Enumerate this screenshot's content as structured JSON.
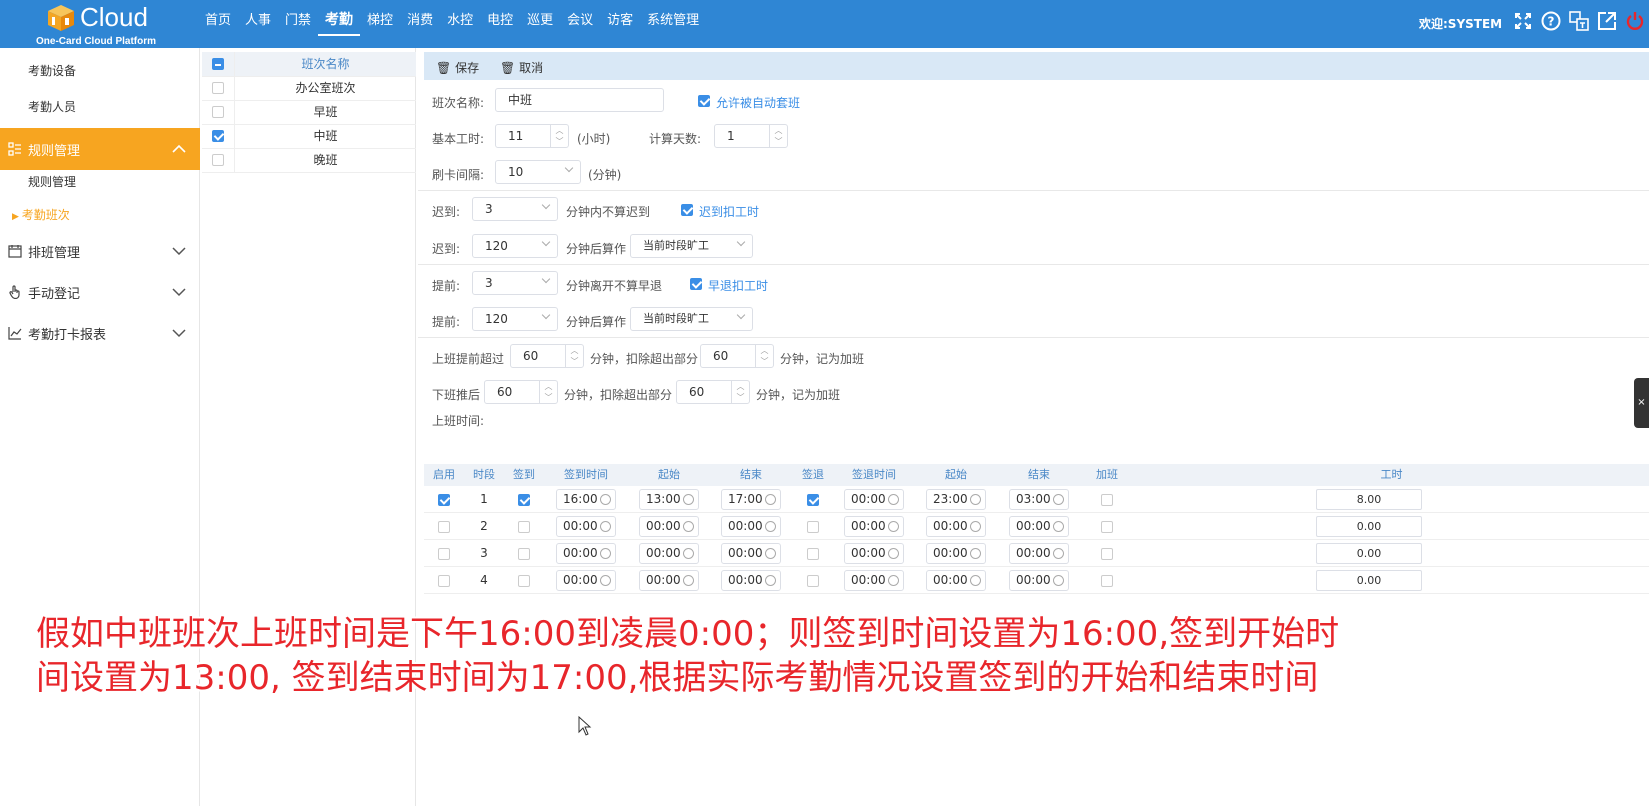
{
  "header": {
    "logo_word": "Cloud",
    "logo_sub": "One-Card Cloud Platform",
    "nav": [
      "首页",
      "人事",
      "门禁",
      "考勤",
      "梯控",
      "消费",
      "水控",
      "电控",
      "巡更",
      "会议",
      "访客",
      "系统管理"
    ],
    "active_nav": "考勤",
    "welcome": "欢迎:SYSTEM",
    "icons": [
      "fullscreen-icon",
      "help-icon",
      "language-icon",
      "export-icon",
      "power-icon"
    ],
    "accent": "#2f86d4"
  },
  "sidebar": {
    "sub_top": [
      "考勤设备",
      "考勤人员"
    ],
    "rule_group": "规则管理",
    "rule_items": [
      "规则管理",
      "考勤班次"
    ],
    "active_item": "考勤班次",
    "groups": [
      "排班管理",
      "手动登记",
      "考勤打卡报表"
    ],
    "active_color": "#f7a520"
  },
  "shift_list": {
    "header": "班次名称",
    "rows": [
      {
        "name": "办公室班次",
        "checked": false
      },
      {
        "name": "早班",
        "checked": false
      },
      {
        "name": "中班",
        "checked": true
      },
      {
        "name": "晚班",
        "checked": false
      }
    ]
  },
  "toolbar": {
    "save": "保存",
    "cancel": "取消"
  },
  "form": {
    "name_label": "班次名称:",
    "name_value": "中班",
    "auto_label": "允许被自动套班",
    "work_label": "基本工时:",
    "work_value": "11",
    "work_unit": "(小时)",
    "days_label": "计算天数:",
    "days_value": "1",
    "interval_label": "刷卡间隔:",
    "interval_value": "10",
    "interval_unit": "(分钟)",
    "late1_label": "迟到:",
    "late1_value": "3",
    "late1_text": "分钟内不算迟到",
    "late_deduct": "迟到扣工时",
    "late2_label": "迟到:",
    "late2_value": "120",
    "late2_text": "分钟后算作",
    "late2_select": "当前时段旷工",
    "early1_label": "提前:",
    "early1_value": "3",
    "early1_text": "分钟离开不算早退",
    "early_deduct": "早退扣工时",
    "early2_label": "提前:",
    "early2_value": "120",
    "early2_text": "分钟后算作",
    "early2_select": "当前时段旷工",
    "ot1_label": "上班提前超过",
    "ot1_value": "60",
    "ot1_mid": "分钟，扣除超出部分",
    "ot1_value2": "60",
    "ot1_end": "分钟，记为加班",
    "ot2_label": "下班推后",
    "ot2_value": "60",
    "ot2_mid": "分钟，扣除超出部分",
    "ot2_value2": "60",
    "ot2_end": "分钟，记为加班",
    "worktime_label": "上班时间:"
  },
  "table": {
    "headers": [
      "启用",
      "时段",
      "签到",
      "签到时间",
      "起始",
      "结束",
      "签退",
      "签退时间",
      "起始",
      "结束",
      "加班",
      "工时"
    ],
    "rows": [
      {
        "enabled": true,
        "seg": "1",
        "signin": true,
        "in_time": "16:00",
        "in_start": "13:00",
        "in_end": "17:00",
        "signout": true,
        "out_time": "00:00",
        "out_start": "23:00",
        "out_end": "03:00",
        "ot": false,
        "hours": "8.00"
      },
      {
        "enabled": false,
        "seg": "2",
        "signin": false,
        "in_time": "00:00",
        "in_start": "00:00",
        "in_end": "00:00",
        "signout": false,
        "out_time": "00:00",
        "out_start": "00:00",
        "out_end": "00:00",
        "ot": false,
        "hours": "0.00"
      },
      {
        "enabled": false,
        "seg": "3",
        "signin": false,
        "in_time": "00:00",
        "in_start": "00:00",
        "in_end": "00:00",
        "signout": false,
        "out_time": "00:00",
        "out_start": "00:00",
        "out_end": "00:00",
        "ot": false,
        "hours": "0.00"
      },
      {
        "enabled": false,
        "seg": "4",
        "signin": false,
        "in_time": "00:00",
        "in_start": "00:00",
        "in_end": "00:00",
        "signout": false,
        "out_time": "00:00",
        "out_start": "00:00",
        "out_end": "00:00",
        "ot": false,
        "hours": "0.00"
      }
    ]
  },
  "caption": {
    "line1": "假如中班班次上班时间是下午16:00到凌晨0:00；则签到时间设置为16:00,签到开始时",
    "line2": "间设置为13:00, 签到结束时间为17:00,根据实际考勤情况设置签到的开始和结束时间",
    "color": "#e8262b"
  }
}
